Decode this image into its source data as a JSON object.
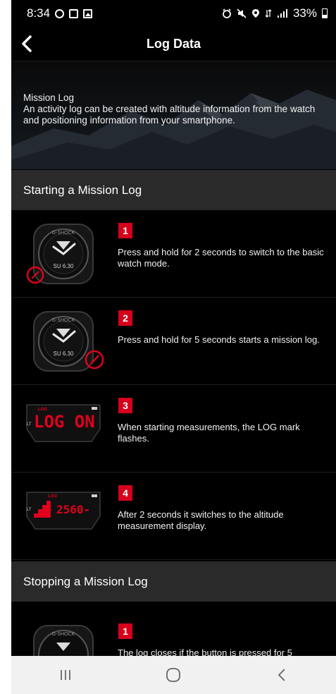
{
  "status_bar": {
    "time": "8:34",
    "left_icons": [
      "sync-icon",
      "square-notification-icon",
      "image-icon"
    ],
    "right_icons": [
      "alarm-icon",
      "mute-icon",
      "location-icon",
      "data-icon",
      "signal-icon"
    ],
    "battery": "33%"
  },
  "header": {
    "title": "Log Data",
    "back_icon": "chevron-left-icon"
  },
  "hero": {
    "title": "Mission Log",
    "description": "An activity log can be created with altitude information from the watch and positioning information from your smartphone."
  },
  "sections": {
    "start_title": "Starting a Mission Log",
    "stop_title": "Stopping a Mission Log"
  },
  "start_steps": [
    {
      "number": "1",
      "text": "Press and hold for 2 seconds to switch to the basic watch mode."
    },
    {
      "number": "2",
      "text": "Press and hold for 5 seconds starts a mission log."
    },
    {
      "number": "3",
      "text": "When starting measurements, the LOG mark flashes."
    },
    {
      "number": "4",
      "text": "After 2 seconds it switches to the altitude measurement display."
    }
  ],
  "stop_steps": [
    {
      "number": "1",
      "text": "The log closes if the button is pressed for 5"
    }
  ],
  "watch_display": {
    "brand": "G-SHOCK",
    "date": "SU 6.30",
    "log_label": "LOG",
    "log_on": "LOG ON",
    "lt": "LT",
    "altitude": "2560-"
  },
  "colors": {
    "accent": "#d6001c",
    "background": "#000000",
    "section": "#2a2a2a"
  },
  "nav_bar": {
    "icons": [
      "recent-apps-icon",
      "home-icon",
      "back-icon"
    ]
  }
}
